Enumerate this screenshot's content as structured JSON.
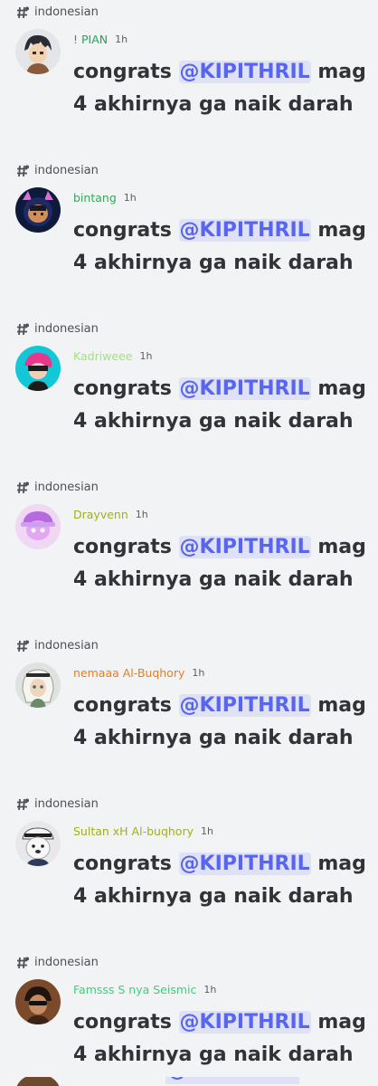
{
  "channel": "indonesian",
  "messages": [
    {
      "user": "! PIAN",
      "color": "#22a559",
      "time": "1h",
      "text_prefix": "congrats",
      "mention": "@KIPITHRIL",
      "text_suffix": "mag 4 akhirnya ga naik darah",
      "avatar": "dark-haired-boy-avatar"
    },
    {
      "user": "bintang",
      "color": "#3ba55d",
      "time": "1h",
      "text_prefix": "congrats",
      "mention": "@KIPITHRIL",
      "text_suffix": "mag 4 akhirnya ga naik darah",
      "avatar": "cat-ear-hood-avatar"
    },
    {
      "user": "Kadriweee",
      "color": "#9fe37c",
      "time": "1h",
      "text_prefix": "congrats",
      "mention": "@KIPITHRIL",
      "text_suffix": "mag 4 akhirnya ga naik darah",
      "avatar": "pink-hair-cyan-avatar"
    },
    {
      "user": "Drayvenn",
      "color": "#a0b01c",
      "time": "1h",
      "text_prefix": "congrats",
      "mention": "@KIPITHRIL",
      "text_suffix": "mag 4 akhirnya ga naik darah",
      "avatar": "purple-hat-avatar"
    },
    {
      "user": "nemaaa Al-Buqhory",
      "color": "#e67e22",
      "time": "1h",
      "text_prefix": "congrats",
      "mention": "@KIPITHRIL",
      "text_suffix": "mag 4 akhirnya ga naik darah",
      "avatar": "keffiyeh-boy-avatar"
    },
    {
      "user": "Sultan xH Al-buqhory",
      "color": "#a0b01c",
      "time": "1h",
      "text_prefix": "congrats",
      "mention": "@KIPITHRIL",
      "text_suffix": "mag 4 akhirnya ga naik darah",
      "avatar": "polar-bear-avatar"
    },
    {
      "user": "Famsss S nya Seismic",
      "color": "#3ad07a",
      "time": "1h",
      "text_prefix": "congrats",
      "mention": "@KIPITHRIL",
      "text_suffix": "mag 4 akhirnya ga naik darah",
      "avatar": "sunglasses-boy-avatar"
    }
  ],
  "partial_next": {
    "mention": "@KIPITHRIL"
  }
}
